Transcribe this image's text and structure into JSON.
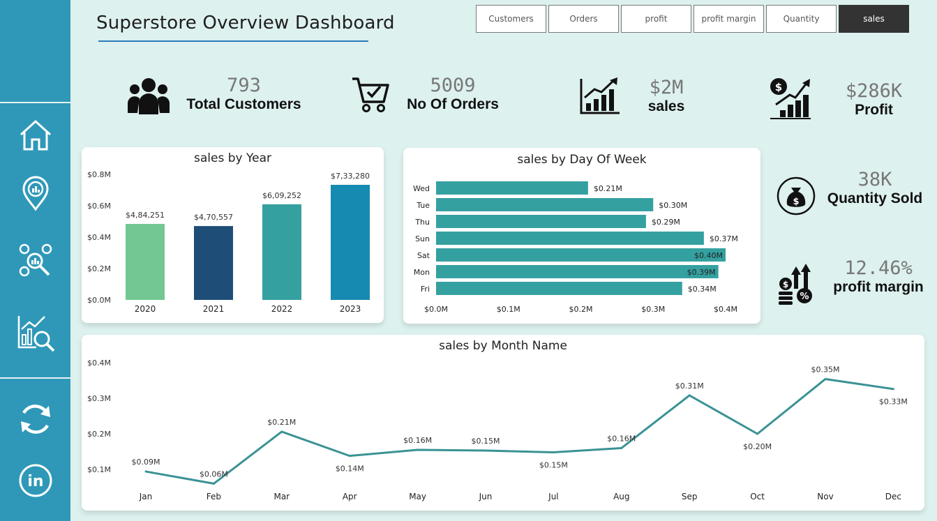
{
  "header": {
    "title": "Superstore Overview Dashboard"
  },
  "slicers": [
    {
      "label": "Customers",
      "active": false
    },
    {
      "label": "Orders",
      "active": false
    },
    {
      "label": "profit",
      "active": false
    },
    {
      "label": "profit margin",
      "active": false
    },
    {
      "label": "Quantity",
      "active": false
    },
    {
      "label": "sales",
      "active": true
    }
  ],
  "sidebar": {
    "icons": [
      "home-icon",
      "location-analytics-icon",
      "people-search-icon",
      "chart-search-icon",
      "refresh-icon",
      "linkedin-icon"
    ]
  },
  "kpis": {
    "customers": {
      "value": "793",
      "label": "Total Customers",
      "icon": "people-icon"
    },
    "orders": {
      "value": "5009",
      "label": "No Of Orders",
      "icon": "cart-icon"
    },
    "sales": {
      "value": "$2M",
      "label": "sales",
      "icon": "bar-growth-icon"
    },
    "profit": {
      "value": "$286K",
      "label": "Profit",
      "icon": "dollar-growth-icon"
    },
    "quantity": {
      "value": "38K",
      "label": "Quantity Sold",
      "icon": "money-bag-icon"
    },
    "margin": {
      "value": "12.46%",
      "label": "profit margin",
      "icon": "coins-percent-icon"
    }
  },
  "colors": {
    "sidebar": "#2f98b8",
    "teal": "#35a0a0",
    "line": "#3a9294",
    "active_slicer": "#333333"
  },
  "chart_data": [
    {
      "type": "bar",
      "title": "sales by Year",
      "categories": [
        "2020",
        "2021",
        "2022",
        "2023"
      ],
      "values": [
        484251,
        470557,
        609252,
        733280
      ],
      "data_labels": [
        "$4,84,251",
        "$4,70,557",
        "$6,09,252",
        "$7,33,280"
      ],
      "colors": [
        "#72c792",
        "#1e4d78",
        "#35a0a0",
        "#168ab0"
      ],
      "yticks": [
        "$0.0M",
        "$0.2M",
        "$0.4M",
        "$0.6M",
        "$0.8M"
      ],
      "ylim": [
        0,
        800000
      ]
    },
    {
      "type": "bar",
      "orientation": "horizontal",
      "title": "sales by Day Of Week",
      "categories": [
        "Wed",
        "Tue",
        "Thu",
        "Sun",
        "Sat",
        "Mon",
        "Fri"
      ],
      "values": [
        0.21,
        0.3,
        0.29,
        0.37,
        0.4,
        0.39,
        0.34
      ],
      "data_labels": [
        "$0.21M",
        "$0.30M",
        "$0.29M",
        "$0.37M",
        "$0.40M",
        "$0.39M",
        "$0.34M"
      ],
      "xticks": [
        "$0.0M",
        "$0.1M",
        "$0.2M",
        "$0.3M",
        "$0.4M"
      ],
      "xlim": [
        0,
        0.4
      ]
    },
    {
      "type": "line",
      "title": "sales by Month Name",
      "categories": [
        "Jan",
        "Feb",
        "Mar",
        "Apr",
        "May",
        "Jun",
        "Jul",
        "Aug",
        "Sep",
        "Oct",
        "Nov",
        "Dec"
      ],
      "values": [
        0.094,
        0.06,
        0.206,
        0.138,
        0.155,
        0.153,
        0.148,
        0.16,
        0.308,
        0.2,
        0.354,
        0.326
      ],
      "data_labels": [
        "$0.09M",
        "$0.06M",
        "$0.21M",
        "$0.14M",
        "$0.16M",
        "$0.15M",
        "$0.15M",
        "$0.16M",
        "$0.31M",
        "$0.20M",
        "$0.35M",
        "$0.33M"
      ],
      "yticks": [
        "$0.1M",
        "$0.2M",
        "$0.3M",
        "$0.4M"
      ],
      "ylim": [
        0.1,
        0.4
      ]
    }
  ]
}
